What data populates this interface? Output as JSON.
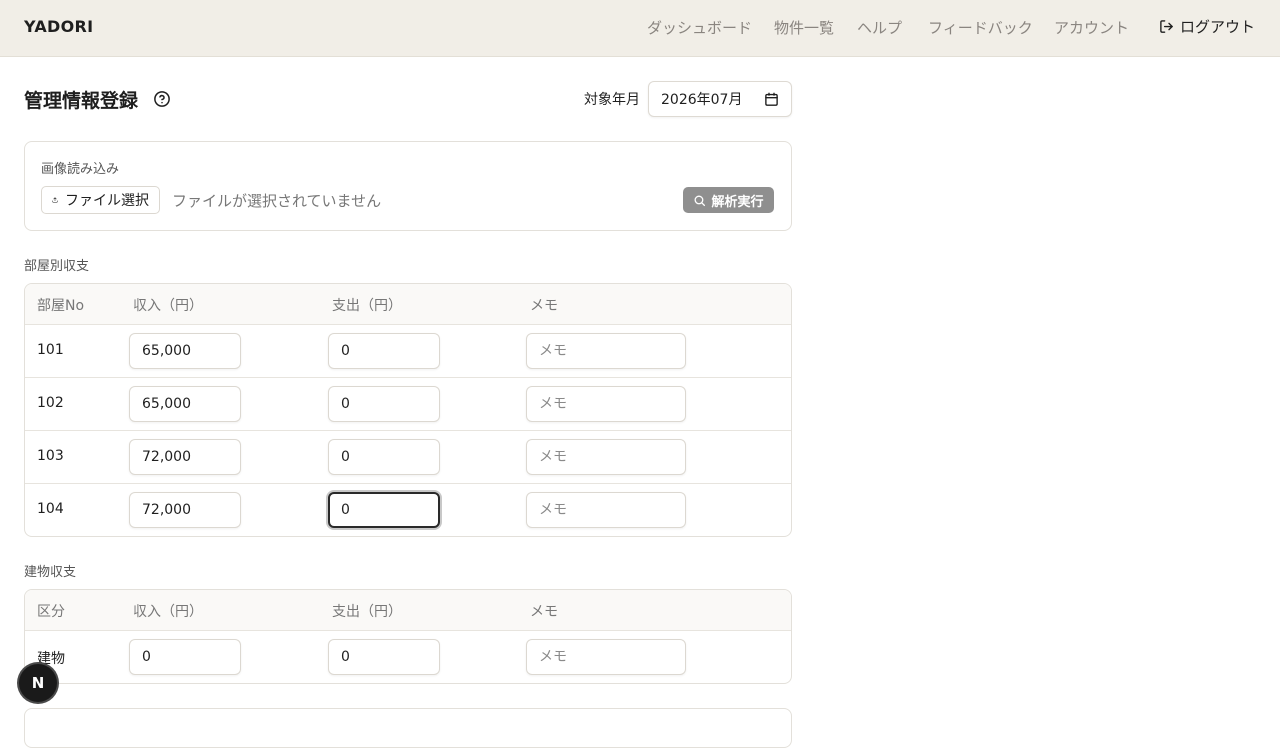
{
  "header": {
    "brand": "YADORI",
    "nav": [
      "ダッシュボード",
      "物件一覧",
      "ヘルプ",
      "フィードバック",
      "アカウント"
    ],
    "logout": "ログアウト"
  },
  "page": {
    "title": "管理情報登録",
    "month_label": "対象年月",
    "month_value": "2026年07月"
  },
  "upload": {
    "label": "画像読み込み",
    "file_button": "ファイル選択",
    "file_status": "ファイルが選択されていません",
    "analyze_button": "解析実行"
  },
  "rooms": {
    "section_label": "部屋別収支",
    "headers": [
      "部屋No",
      "収入（円）",
      "支出（円）",
      "メモ"
    ],
    "memo_placeholder": "メモ",
    "rows": [
      {
        "room": "101",
        "income": "65,000",
        "expense": "0"
      },
      {
        "room": "102",
        "income": "65,000",
        "expense": "0"
      },
      {
        "room": "103",
        "income": "72,000",
        "expense": "0"
      },
      {
        "room": "104",
        "income": "72,000",
        "expense": "0"
      }
    ]
  },
  "building": {
    "section_label": "建物収支",
    "headers": [
      "区分",
      "収入（円）",
      "支出（円）",
      "メモ"
    ],
    "memo_placeholder": "メモ",
    "rows": [
      {
        "category": "建物",
        "income": "0",
        "expense": "0"
      }
    ]
  },
  "dev_badge": "N",
  "icons": {
    "help": "help-circle-icon",
    "logout": "logout-icon",
    "calendar": "calendar-icon",
    "upload": "upload-icon",
    "search": "search-icon"
  }
}
